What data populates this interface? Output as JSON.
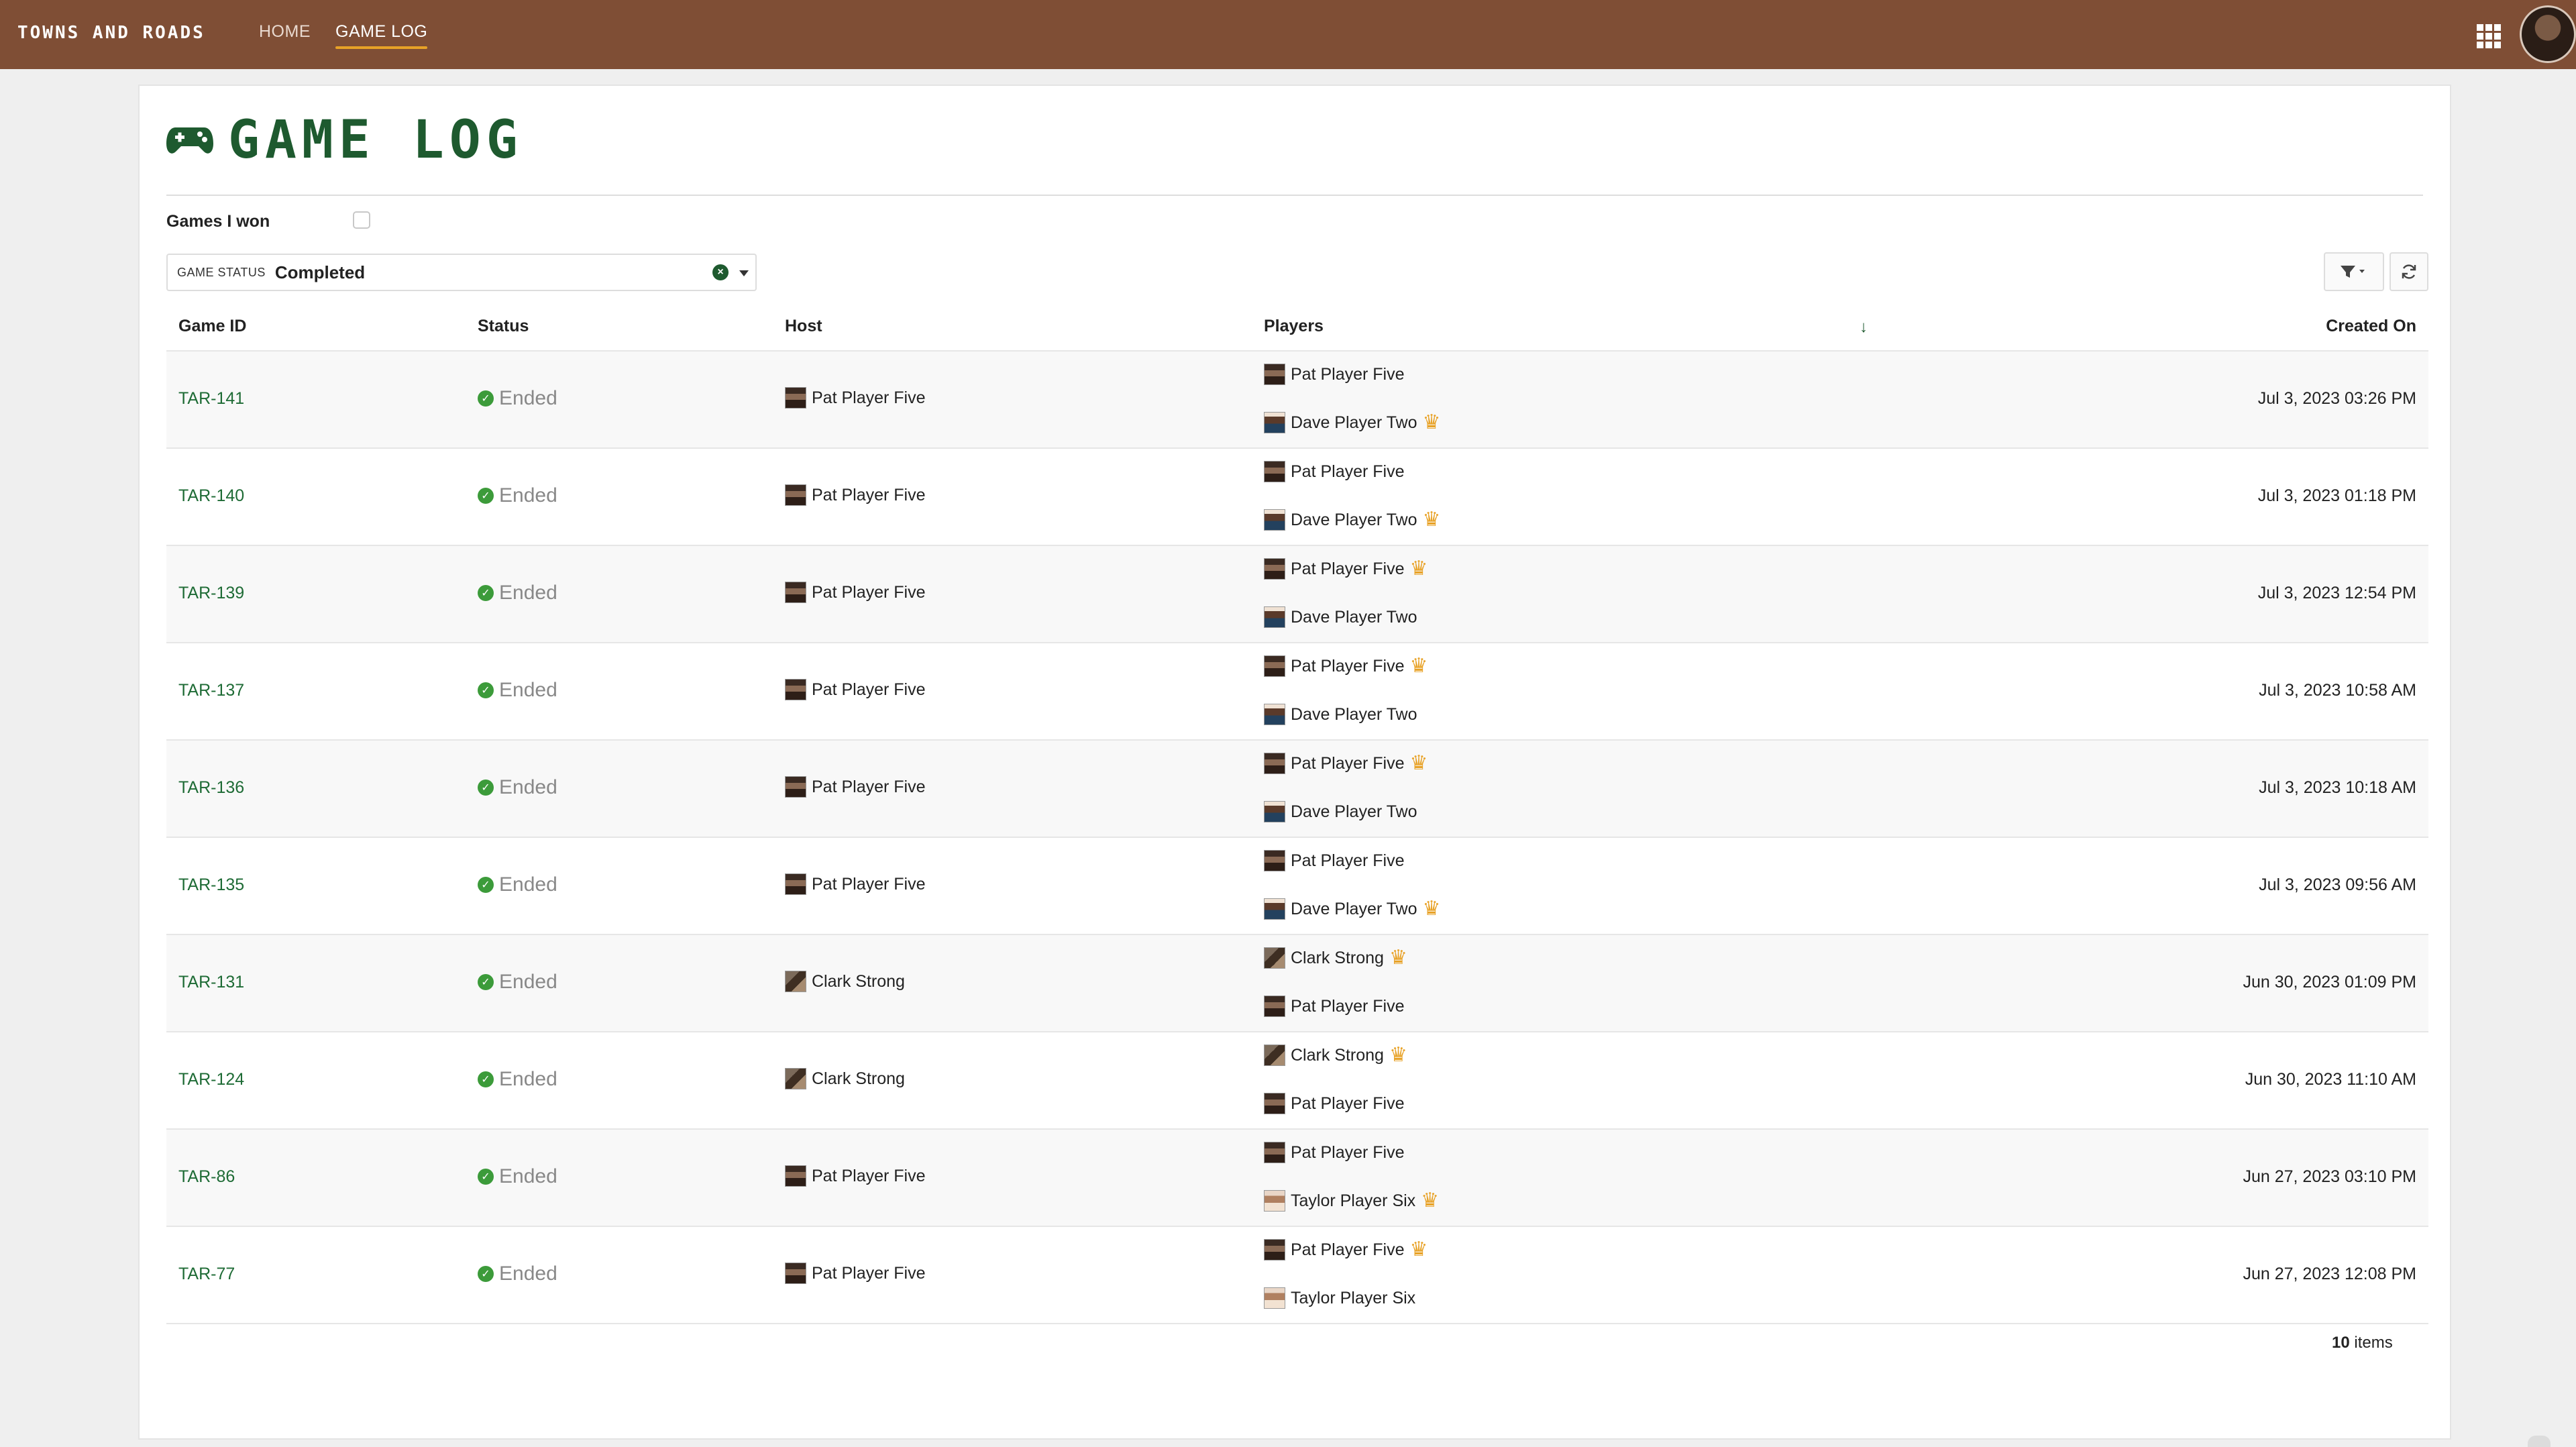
{
  "app": {
    "brand": "TOWNS AND ROADS",
    "nav": [
      {
        "label": "HOME",
        "active": false
      },
      {
        "label": "GAME LOG",
        "active": true
      }
    ],
    "accent_color": "#e8a227",
    "topbar_color": "#7f4e35",
    "brand_green": "#1e5a2f"
  },
  "page": {
    "title": "GAME LOG",
    "title_icon": "gamepad-icon"
  },
  "filters": {
    "games_won_label": "Games I won",
    "games_won_checked": false,
    "status_label": "GAME STATUS",
    "status_value": "Completed"
  },
  "table": {
    "columns": [
      "Game ID",
      "Status",
      "Host",
      "Players",
      "Created On"
    ],
    "rows": [
      {
        "id": "TAR-141",
        "status": "Ended",
        "host": {
          "name": "Pat Player Five",
          "avatar": "pat"
        },
        "players": [
          {
            "name": "Pat Player Five",
            "avatar": "pat",
            "winner": false
          },
          {
            "name": "Dave Player Two",
            "avatar": "dave",
            "winner": true
          }
        ],
        "created": "Jul 3, 2023 03:26 PM"
      },
      {
        "id": "TAR-140",
        "status": "Ended",
        "host": {
          "name": "Pat Player Five",
          "avatar": "pat"
        },
        "players": [
          {
            "name": "Pat Player Five",
            "avatar": "pat",
            "winner": false
          },
          {
            "name": "Dave Player Two",
            "avatar": "dave",
            "winner": true
          }
        ],
        "created": "Jul 3, 2023 01:18 PM"
      },
      {
        "id": "TAR-139",
        "status": "Ended",
        "host": {
          "name": "Pat Player Five",
          "avatar": "pat"
        },
        "players": [
          {
            "name": "Pat Player Five",
            "avatar": "pat",
            "winner": true
          },
          {
            "name": "Dave Player Two",
            "avatar": "dave",
            "winner": false
          }
        ],
        "created": "Jul 3, 2023 12:54 PM"
      },
      {
        "id": "TAR-137",
        "status": "Ended",
        "host": {
          "name": "Pat Player Five",
          "avatar": "pat"
        },
        "players": [
          {
            "name": "Pat Player Five",
            "avatar": "pat",
            "winner": true
          },
          {
            "name": "Dave Player Two",
            "avatar": "dave",
            "winner": false
          }
        ],
        "created": "Jul 3, 2023 10:58 AM"
      },
      {
        "id": "TAR-136",
        "status": "Ended",
        "host": {
          "name": "Pat Player Five",
          "avatar": "pat"
        },
        "players": [
          {
            "name": "Pat Player Five",
            "avatar": "pat",
            "winner": true
          },
          {
            "name": "Dave Player Two",
            "avatar": "dave",
            "winner": false
          }
        ],
        "created": "Jul 3, 2023 10:18 AM"
      },
      {
        "id": "TAR-135",
        "status": "Ended",
        "host": {
          "name": "Pat Player Five",
          "avatar": "pat"
        },
        "players": [
          {
            "name": "Pat Player Five",
            "avatar": "pat",
            "winner": false
          },
          {
            "name": "Dave Player Two",
            "avatar": "dave",
            "winner": true
          }
        ],
        "created": "Jul 3, 2023 09:56 AM"
      },
      {
        "id": "TAR-131",
        "status": "Ended",
        "host": {
          "name": "Clark Strong",
          "avatar": "clark"
        },
        "players": [
          {
            "name": "Clark Strong",
            "avatar": "clark",
            "winner": true
          },
          {
            "name": "Pat Player Five",
            "avatar": "pat",
            "winner": false
          }
        ],
        "created": "Jun 30, 2023 01:09 PM"
      },
      {
        "id": "TAR-124",
        "status": "Ended",
        "host": {
          "name": "Clark Strong",
          "avatar": "clark"
        },
        "players": [
          {
            "name": "Clark Strong",
            "avatar": "clark",
            "winner": true
          },
          {
            "name": "Pat Player Five",
            "avatar": "pat",
            "winner": false
          }
        ],
        "created": "Jun 30, 2023 11:10 AM"
      },
      {
        "id": "TAR-86",
        "status": "Ended",
        "host": {
          "name": "Pat Player Five",
          "avatar": "pat"
        },
        "players": [
          {
            "name": "Pat Player Five",
            "avatar": "pat",
            "winner": false
          },
          {
            "name": "Taylor Player Six",
            "avatar": "taylor",
            "winner": true
          }
        ],
        "created": "Jun 27, 2023 03:10 PM"
      },
      {
        "id": "TAR-77",
        "status": "Ended",
        "host": {
          "name": "Pat Player Five",
          "avatar": "pat"
        },
        "players": [
          {
            "name": "Pat Player Five",
            "avatar": "pat",
            "winner": true
          },
          {
            "name": "Taylor Player Six",
            "avatar": "taylor",
            "winner": false
          }
        ],
        "created": "Jun 27, 2023 12:08 PM"
      }
    ],
    "item_count": "10",
    "item_count_suffix": "items"
  }
}
